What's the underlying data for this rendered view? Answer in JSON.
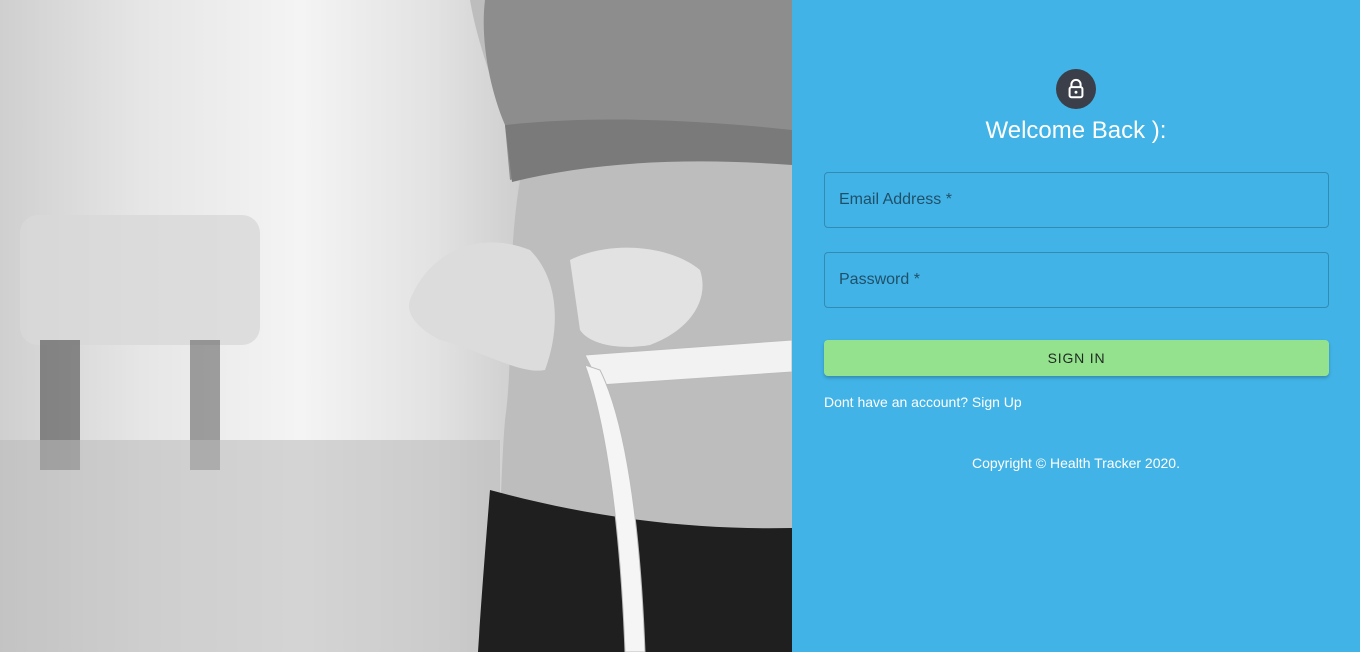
{
  "hero": {
    "image_description_icon": "tape-measure-waist-photo"
  },
  "login": {
    "lock_icon": "lock-icon",
    "title": "Welcome Back ):",
    "email_placeholder": "Email Address *",
    "password_placeholder": "Password *",
    "sign_in_label": "SIGN IN",
    "signup_link": "Dont have an account? Sign Up",
    "copyright": "Copyright © Health Tracker 2020."
  },
  "colors": {
    "panel_bg": "#41b3e6",
    "button_bg": "#95e28e",
    "avatar_bg": "#3a3f4a"
  }
}
